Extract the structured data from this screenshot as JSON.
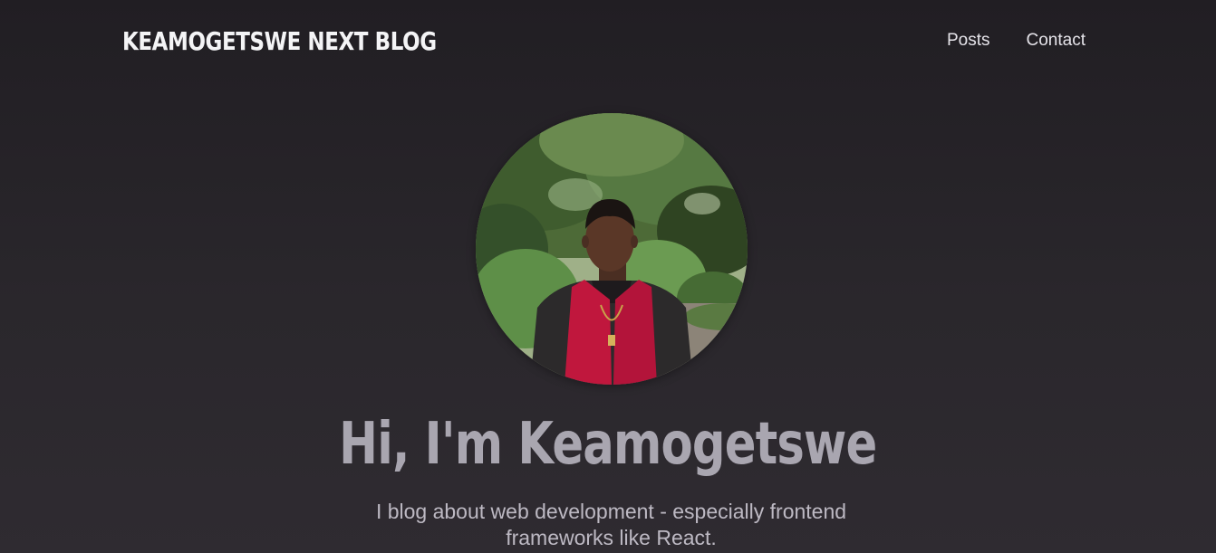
{
  "header": {
    "logo_text": "KEAMOGETSWE NEXT BLOG",
    "nav": [
      {
        "label": "Posts"
      },
      {
        "label": "Contact"
      }
    ]
  },
  "hero": {
    "title": "Hi, I'm Keamogetswe",
    "subtitle": "I blog about web development - especially frontend frameworks like React."
  },
  "colors": {
    "background": "#262328",
    "logo": "#f4f4f6",
    "title": "#a9a6b0",
    "subtitle": "#bdb9c3",
    "scarf": "#c0173d"
  }
}
